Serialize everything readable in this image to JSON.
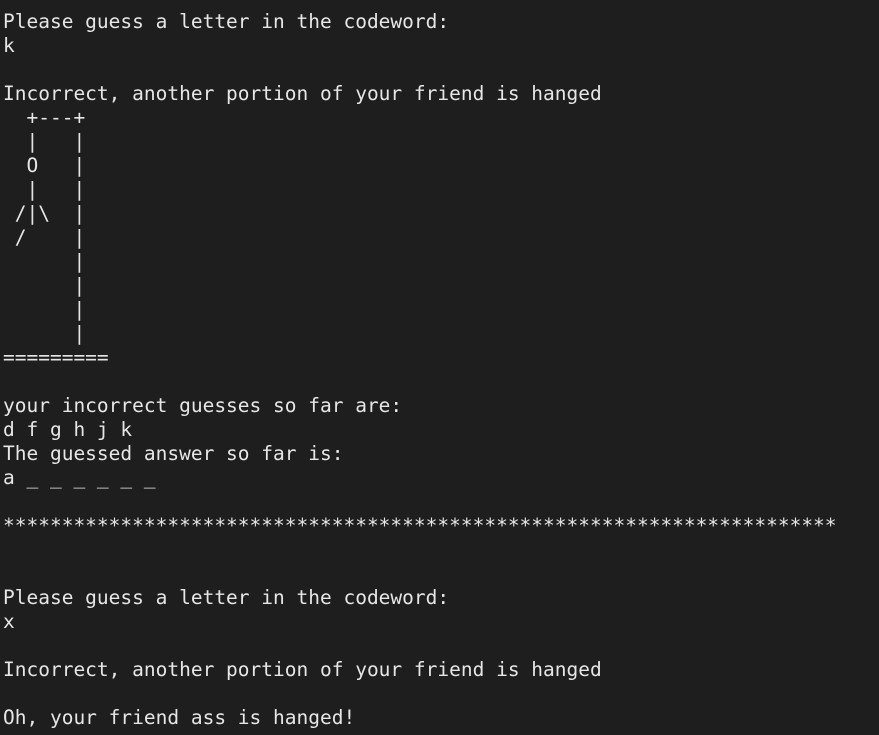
{
  "terminal": {
    "background": "#1e1e1e",
    "foreground": "#e6e6e6",
    "lines": [
      "Please guess a letter in the codeword:",
      "k",
      "",
      "Incorrect, another portion of your friend is hanged",
      "  +---+",
      "  |   |",
      "  O   |",
      "  |   |",
      " /|\\  |",
      " /    |",
      "      |",
      "      |",
      "      |",
      "      |",
      "=========",
      "",
      "your incorrect guesses so far are:",
      "d f g h j k",
      "The guessed answer so far is:",
      "a _ _ _ _ _ _",
      "",
      "***********************************************************************",
      "",
      "",
      "Please guess a letter in the codeword:",
      "x",
      "",
      "Incorrect, another portion of your friend is hanged",
      "",
      "Oh, your friend ass is hanged!"
    ]
  }
}
